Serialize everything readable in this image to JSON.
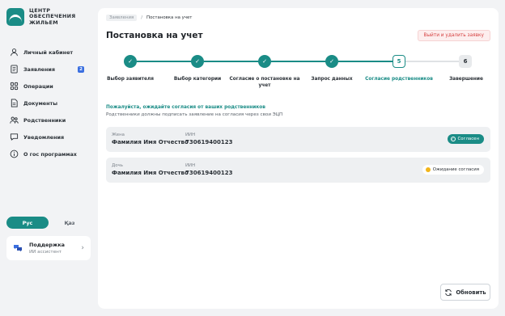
{
  "brand": {
    "line1": "ЦЕНТР",
    "line2": "ОБЕСПЕЧЕНИЯ",
    "line3": "ЖИЛЬЕМ"
  },
  "nav": [
    {
      "label": "Личный кабинет",
      "icon": "user-icon"
    },
    {
      "label": "Заявления",
      "icon": "document-icon",
      "badge": "2"
    },
    {
      "label": "Операции",
      "icon": "grid-icon"
    },
    {
      "label": "Документы",
      "icon": "file-icon"
    },
    {
      "label": "Родственники",
      "icon": "people-icon"
    },
    {
      "label": "Уведомления",
      "icon": "chat-icon"
    },
    {
      "label": "О гос программах",
      "icon": "info-icon"
    }
  ],
  "lang": {
    "ru": "Рус",
    "kz": "Қаз"
  },
  "support": {
    "title": "Поддержка",
    "subtitle": "ИИ ассистент"
  },
  "breadcrumb": {
    "first": "Заявления",
    "sep": "/",
    "current": "Постановка на учет"
  },
  "page_title": "Постановка на учет",
  "exit_button": "Выйти и удалить заявку",
  "steps": [
    {
      "label": "Выбор заявителя",
      "state": "done",
      "marker": "✓"
    },
    {
      "label": "Выбор категории",
      "state": "done",
      "marker": "✓"
    },
    {
      "label": "Согласие о постановке на учет",
      "state": "done",
      "marker": "✓"
    },
    {
      "label": "Запрос данных",
      "state": "done",
      "marker": "✓"
    },
    {
      "label": "Согласие родственников",
      "state": "current",
      "marker": "5"
    },
    {
      "label": "Завершение",
      "state": "future",
      "marker": "6"
    }
  ],
  "notice": {
    "title": "Пожалуйста, ожидайте согласия от ваших родственников",
    "subtitle": "Родственники должны подписать заявление на согласия через свои ЭЦП"
  },
  "relatives": [
    {
      "relation": "Жена",
      "name": "Фамилия Имя Отчество",
      "iin_label": "ИИН",
      "iin": "730619400123",
      "status": "Согласен",
      "status_type": "ok"
    },
    {
      "relation": "Дочь",
      "name": "Фамилия Имя Отчество",
      "iin_label": "ИИН",
      "iin": "730619400123",
      "status": "Ожидание согласия",
      "status_type": "wait"
    }
  ],
  "refresh_button": "Обновить",
  "colors": {
    "accent": "#1a8c86",
    "danger": "#d64343",
    "badge": "#3b6fe0",
    "wait": "#f2b51a"
  }
}
